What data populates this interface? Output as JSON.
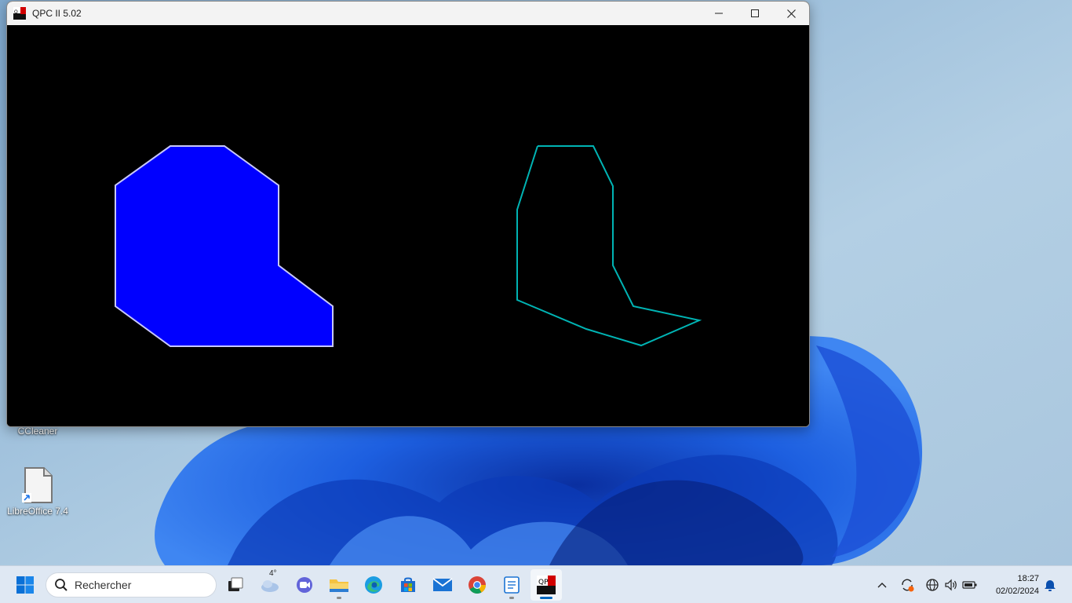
{
  "window": {
    "title": "QPC II 5.02",
    "minimize_icon": "minimize-icon",
    "maximize_icon": "maximize-icon",
    "close_icon": "close-icon"
  },
  "canvas": {
    "background": "#000000",
    "filled_polygon": {
      "fill": "#0000ff",
      "outline": "#c8c8ff"
    },
    "outline_polygon": {
      "stroke": "#00b4b4"
    }
  },
  "desktop": {
    "icons": [
      {
        "label": "CCleaner",
        "icon": "ccleaner-icon"
      },
      {
        "label": "LibreOffice 7.4",
        "icon": "libreoffice-icon"
      }
    ]
  },
  "taskbar": {
    "search_placeholder": "Rechercher",
    "weather_temp": "4°",
    "apps": [
      "start-icon",
      "task-view-icon",
      "weather-icon",
      "teams-chat-icon",
      "file-explorer-icon",
      "edge-icon",
      "store-icon",
      "mail-icon",
      "chrome-icon",
      "notepad-icon",
      "qpc-icon"
    ],
    "time": "18:27",
    "date": "02/02/2024",
    "accent": "#0067c0"
  }
}
